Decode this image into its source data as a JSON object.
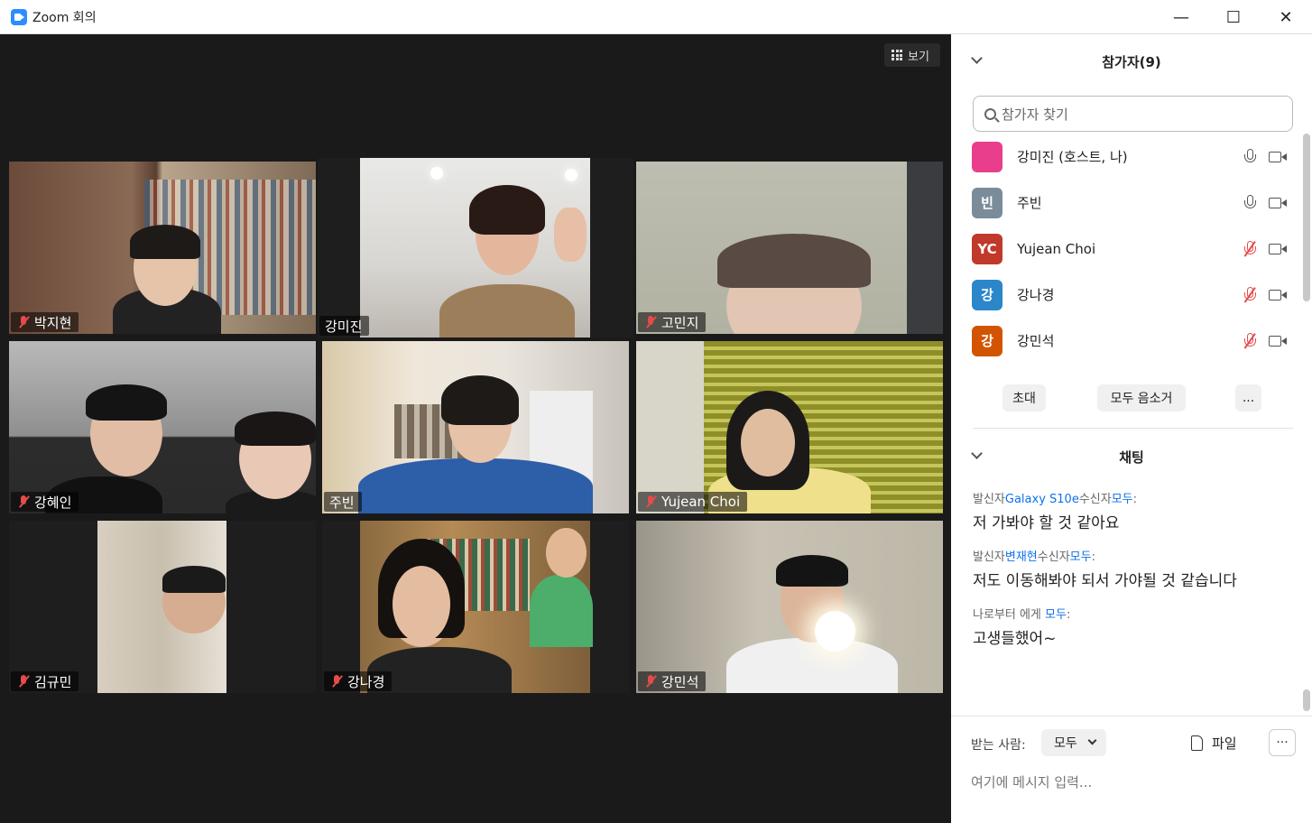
{
  "window": {
    "title": "Zoom 회의"
  },
  "video": {
    "view_label": "보기",
    "tiles": [
      {
        "name": "박지현",
        "muted": true
      },
      {
        "name": "강미진",
        "muted": false
      },
      {
        "name": "고민지",
        "muted": true
      },
      {
        "name": "강혜인",
        "muted": true
      },
      {
        "name": "주빈",
        "muted": false
      },
      {
        "name": "Yujean Choi",
        "muted": true
      },
      {
        "name": "김규민",
        "muted": true
      },
      {
        "name": "강나경",
        "muted": true
      },
      {
        "name": "강민석",
        "muted": true
      }
    ]
  },
  "participants": {
    "title": "참가자(9)",
    "search_placeholder": "참가자 찾기",
    "list": [
      {
        "avatar": "",
        "avatar_color": "#e83e8c",
        "name": "강미진 (호스트, 나)",
        "muted": false
      },
      {
        "avatar": "빈",
        "avatar_color": "#7a8c99",
        "name": "주빈",
        "muted": false
      },
      {
        "avatar": "YC",
        "avatar_color": "#c0392b",
        "name": "Yujean Choi",
        "muted": true
      },
      {
        "avatar": "강",
        "avatar_color": "#2b87c9",
        "name": "강나경",
        "muted": true
      },
      {
        "avatar": "강",
        "avatar_color": "#d35400",
        "name": "강민석",
        "muted": true
      }
    ],
    "actions": {
      "invite": "초대",
      "mute_all": "모두 음소거",
      "more": "..."
    }
  },
  "chat": {
    "title": "채팅",
    "messages": [
      {
        "prefix": "발신자",
        "sender": "Galaxy S10e",
        "mid": "수신자",
        "recipient": "모두",
        "suffix": ":",
        "text": "저 가봐야 할 것 같아요"
      },
      {
        "prefix": "발신자",
        "sender": "변재현",
        "mid": "수신자",
        "recipient": "모두",
        "suffix": ":",
        "text": "저도 이동해봐야 되서 가야될 것 같습니다"
      },
      {
        "prefix": "나로부터 에게 ",
        "sender": "",
        "mid": "",
        "recipient": "모두",
        "suffix": ":",
        "text": "고생들했어~"
      }
    ],
    "to_label": "받는 사람:",
    "to_value": "모두",
    "file_label": "파일",
    "more_label": "···",
    "input_placeholder": "여기에 메시지 입력..."
  }
}
